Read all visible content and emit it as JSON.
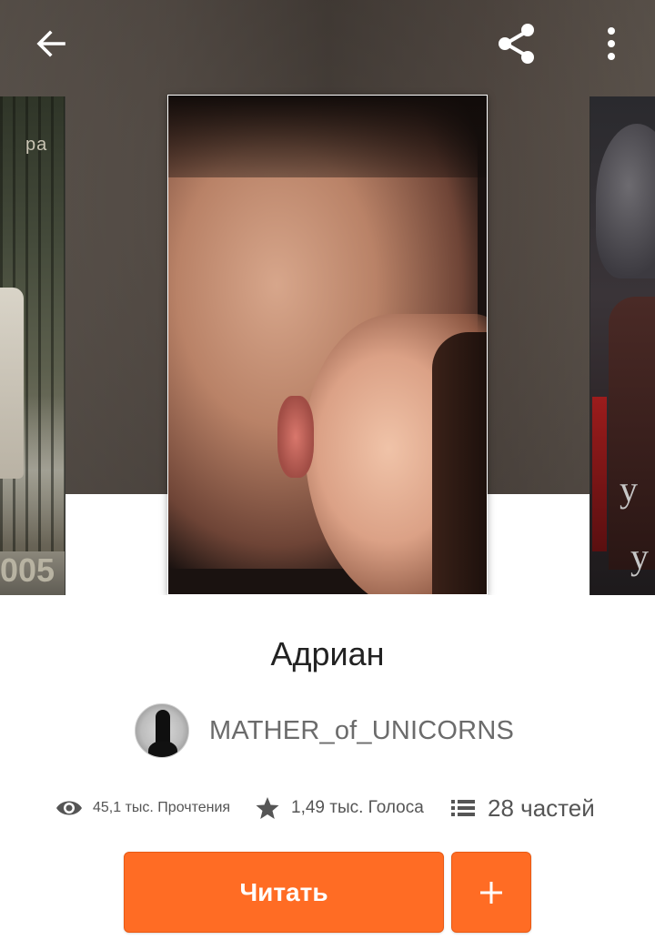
{
  "toolbar": {
    "back_icon": "arrow-left-icon",
    "share_icon": "share-icon",
    "more_icon": "more-vertical-icon"
  },
  "covers": {
    "left": {
      "text_top": "ра",
      "text_bottom": "005"
    },
    "right": {
      "text_1": "у",
      "text_2": "у"
    }
  },
  "story": {
    "title": "Адриан",
    "author": "MATHER_of_UNICORNS",
    "reads": "45,1 тыс. Прочтения",
    "votes": "1,49 тыс. Голоса",
    "parts": "28 частей"
  },
  "actions": {
    "read_label": "Читать",
    "add_icon": "plus-icon"
  },
  "colors": {
    "accent": "#ff6c24",
    "title": "#222222",
    "author": "#6b6b6b",
    "stats": "#555555"
  }
}
